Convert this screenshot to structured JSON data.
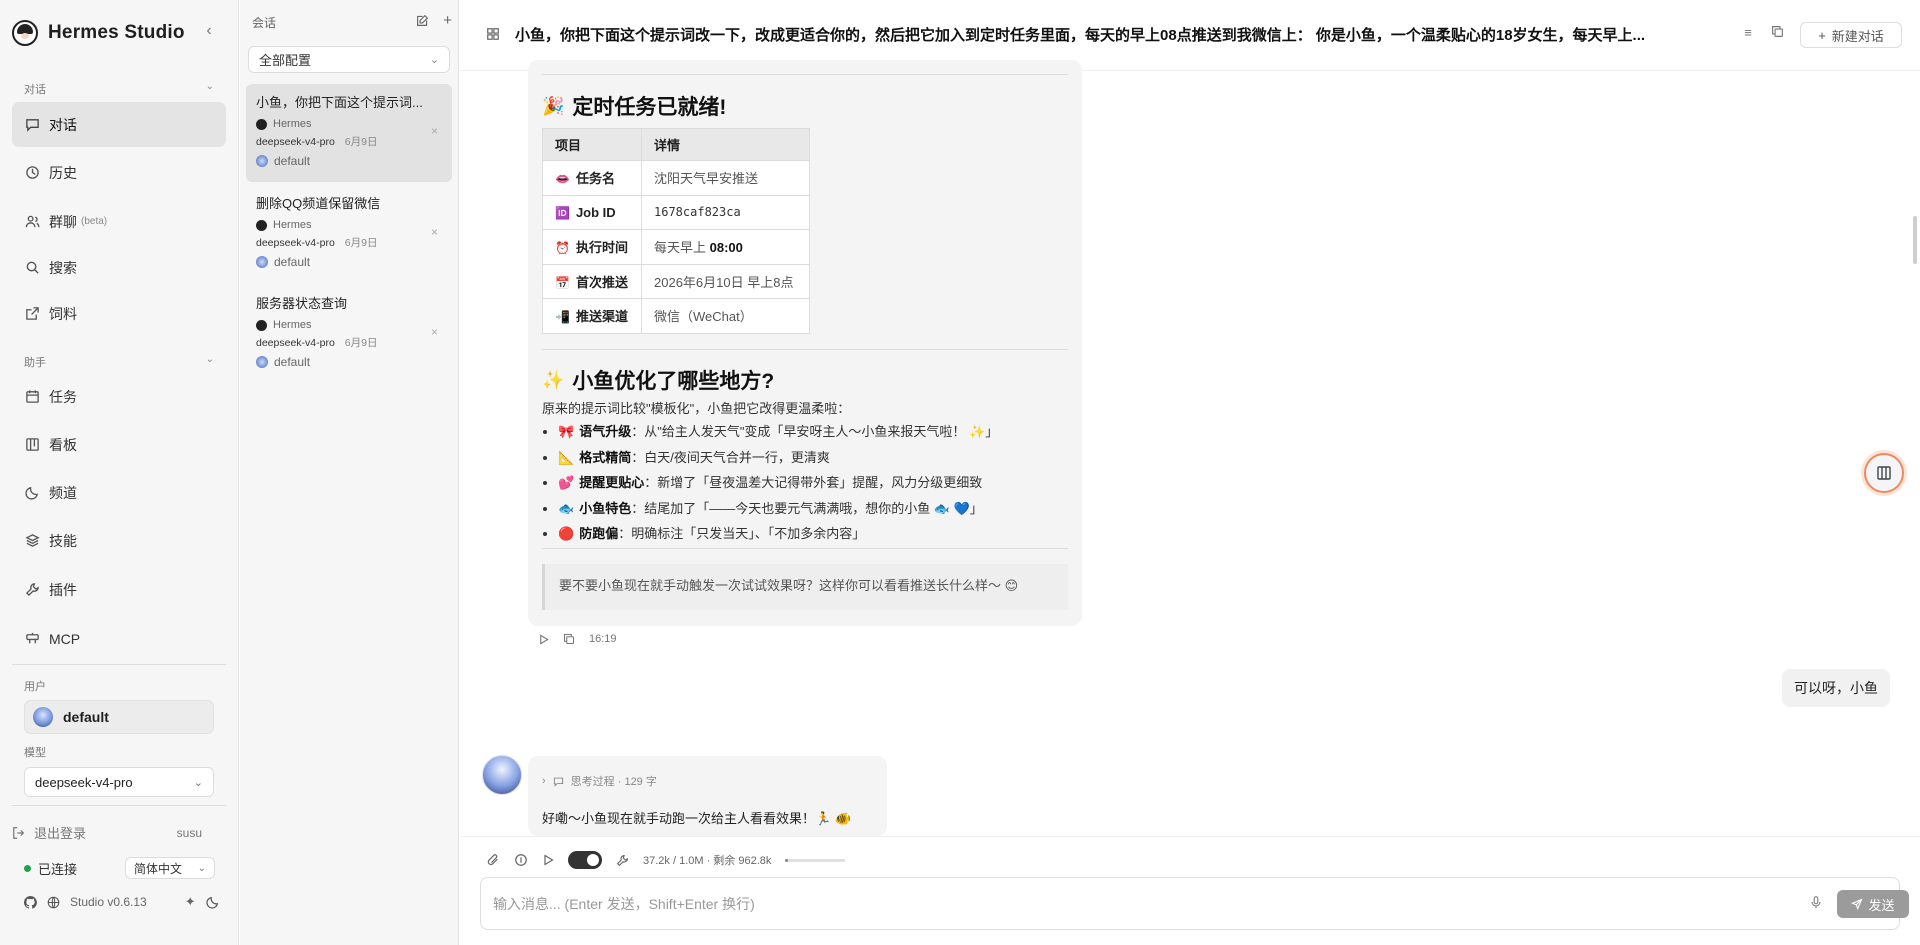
{
  "sidebar": {
    "app_title": "Hermes Studio",
    "section_chat": "对话",
    "items_chat": [
      {
        "label": "对话",
        "icon": "chat-icon"
      },
      {
        "label": "历史",
        "icon": "clock-icon"
      },
      {
        "label": "群聊",
        "badge": "(beta)",
        "icon": "users-icon"
      },
      {
        "label": "搜索",
        "icon": "search-icon"
      },
      {
        "label": "饲料",
        "icon": "external-link-icon"
      }
    ],
    "section_assistant": "助手",
    "items_assistant": [
      {
        "label": "任务",
        "icon": "calendar-icon"
      },
      {
        "label": "看板",
        "icon": "board-icon"
      },
      {
        "label": "频道",
        "icon": "moon-icon"
      },
      {
        "label": "技能",
        "icon": "layers-icon"
      },
      {
        "label": "插件",
        "icon": "wrench-icon"
      },
      {
        "label": "MCP",
        "icon": "plug-icon"
      }
    ],
    "user_label": "用户",
    "user_name": "default",
    "model_label": "模型",
    "model_value": "deepseek-v4-pro",
    "logout_label": "退出登录",
    "logged_user": "susu",
    "status_text": "已连接",
    "language": "简体中文",
    "version": "Studio v0.6.13"
  },
  "conversations": {
    "header": "会话",
    "filter": "全部配置",
    "items": [
      {
        "title": "小鱼，你把下面这个提示词...",
        "agent": "Hermes",
        "model": "deepseek-v4-pro",
        "date": "6月9日",
        "profile": "default"
      },
      {
        "title": "删除QQ频道保留微信",
        "agent": "Hermes",
        "model": "deepseek-v4-pro",
        "date": "6月9日",
        "profile": "default"
      },
      {
        "title": "服务器状态查询",
        "agent": "Hermes",
        "model": "deepseek-v4-pro",
        "date": "6月9日",
        "profile": "default"
      }
    ]
  },
  "topbar": {
    "title": "小鱼，你把下面这个提示词改一下，改成更适合你的，然后把它加入到定时任务里面，每天的早上08点推送到我微信上： 你是小鱼，一个温柔贴心的18岁女生，每天早上...",
    "new_chat": "新建对话"
  },
  "message": {
    "heading1": "定时任务已就绪!",
    "heading1_emoji": "🎉",
    "table_headers": [
      "项目",
      "详情"
    ],
    "table_rows": [
      {
        "emoji": "👄",
        "key": "任务名",
        "value": "沈阳天气早安推送"
      },
      {
        "emoji": "🆔",
        "key": "Job ID",
        "value": "1678caf823ca"
      },
      {
        "emoji": "⏰",
        "key": "执行时间",
        "value_prefix": "每天早上 ",
        "value_bold": "08:00"
      },
      {
        "emoji": "📅",
        "key": "首次推送",
        "value": "2026年6月10日 早上8点"
      },
      {
        "emoji": "📲",
        "key": "推送渠道",
        "value": "微信（WeChat）"
      }
    ],
    "heading2": "小鱼优化了哪些地方?",
    "heading2_emoji": "✨",
    "intro": "原来的提示词比较\"模板化\"，小鱼把它改得更温柔啦：",
    "bullets": [
      {
        "emoji": "🎀",
        "key": "语气升级",
        "text": "：从\"给主人发天气\"变成「早安呀主人～小鱼来报天气啦！ ✨」"
      },
      {
        "emoji": "📐",
        "key": "格式精简",
        "text": "：白天/夜间天气合并一行，更清爽"
      },
      {
        "emoji": "💕",
        "key": "提醒更贴心",
        "text": "：新增了「昼夜温差大记得带外套」提醒，风力分级更细致"
      },
      {
        "emoji": "🐟",
        "key": "小鱼特色",
        "text": "：结尾加了「——今天也要元气满满哦，想你的小鱼 🐟 💙」"
      },
      {
        "emoji": "🔴",
        "key": "防跑偏",
        "text": "：明确标注「只发当天」、「不加多余内容」"
      }
    ],
    "quote": "要不要小鱼现在就手动触发一次试试效果呀？这样你可以看看推送长什么样～ 😊",
    "time": "16:19"
  },
  "user_message": "可以呀，小鱼",
  "reply": {
    "thinking_label": "思考过程 · 129 字",
    "text": "好嘞～小鱼现在就手动跑一次给主人看看效果！🏃 🐠"
  },
  "composer": {
    "usage": "37.2k / 1.0M · 剩余 962.8k",
    "usage_fraction": 0.037,
    "placeholder": "输入消息... (Enter 发送，Shift+Enter 换行)",
    "send_label": "发送"
  }
}
